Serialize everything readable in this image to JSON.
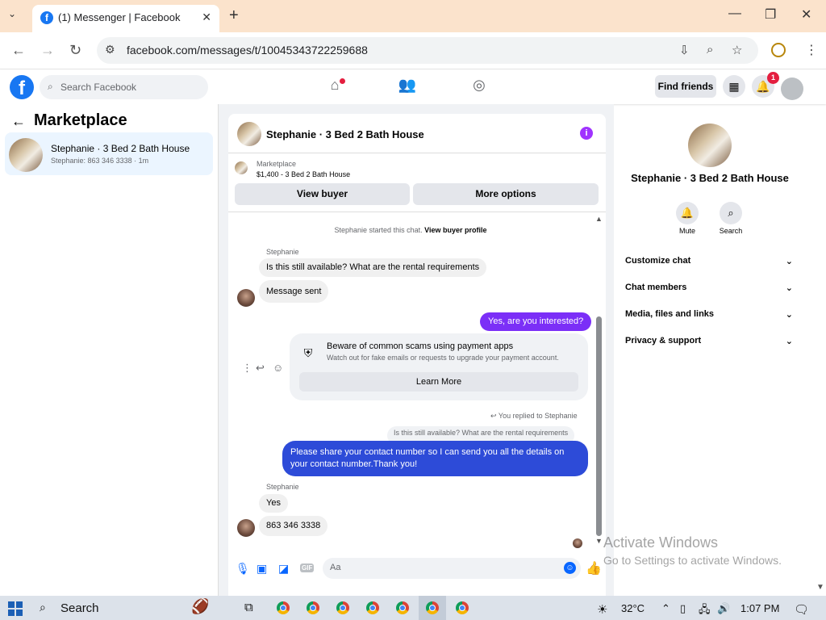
{
  "browser": {
    "tab_title": "(1) Messenger | Facebook",
    "url": "facebook.com/messages/t/10045343722259688",
    "new_tab": "+",
    "close_tab": "✕"
  },
  "fb_header": {
    "logo": "f",
    "search_placeholder": "Search Facebook",
    "find_friends": "Find friends",
    "notification_count": "1"
  },
  "left_panel": {
    "title": "Marketplace",
    "conversations": [
      {
        "name": "Stephanie · 3 Bed 2 Bath House",
        "preview": "Stephanie: 863 346 3338 · 1m"
      }
    ]
  },
  "chat": {
    "header_name": "Stephanie · 3 Bed 2 Bath House",
    "listing_source": "Marketplace",
    "listing_info": "$1,400 - 3 Bed 2 Bath House",
    "view_buyer": "View buyer",
    "more_options": "More options",
    "system_text": "Stephanie started this chat.",
    "system_link": "View buyer profile",
    "messages": [
      {
        "sender": "Stephanie",
        "text": "Is this still available? What are the rental requirements"
      },
      {
        "text": "Message sent"
      },
      {
        "text": "Yes, are you interested?"
      },
      {
        "text": "Please share your contact number so I can send you all the details on your contact number.Thank you!"
      },
      {
        "sender": "Stephanie",
        "text": "Yes"
      },
      {
        "text": "863 346 3338"
      }
    ],
    "scam_card": {
      "title": "Beware of common scams using payment apps",
      "subtitle": "Watch out for fake emails or requests to upgrade your payment account.",
      "button": "Learn More"
    },
    "reply_label": "You replied to Stephanie",
    "quoted_text": "Is this still available? What are the rental requirements",
    "composer_placeholder": "Aa",
    "gif_label": "GIF"
  },
  "right_panel": {
    "name": "Stephanie · 3 Bed 2 Bath House",
    "mute": "Mute",
    "search": "Search",
    "sections": [
      "Customize chat",
      "Chat members",
      "Media, files and links",
      "Privacy & support"
    ]
  },
  "watermark": {
    "line1": "Activate Windows",
    "line2": "Go to Settings to activate Windows."
  },
  "taskbar": {
    "search": "Search",
    "temperature": "32°C",
    "time": "1:07 PM"
  },
  "colors": {
    "facebook_blue": "#1877f2",
    "outgoing_purple": "#7b2ff7",
    "outgoing_blue": "#2d4bd8",
    "browser_tabbar": "#fbe3cc"
  }
}
